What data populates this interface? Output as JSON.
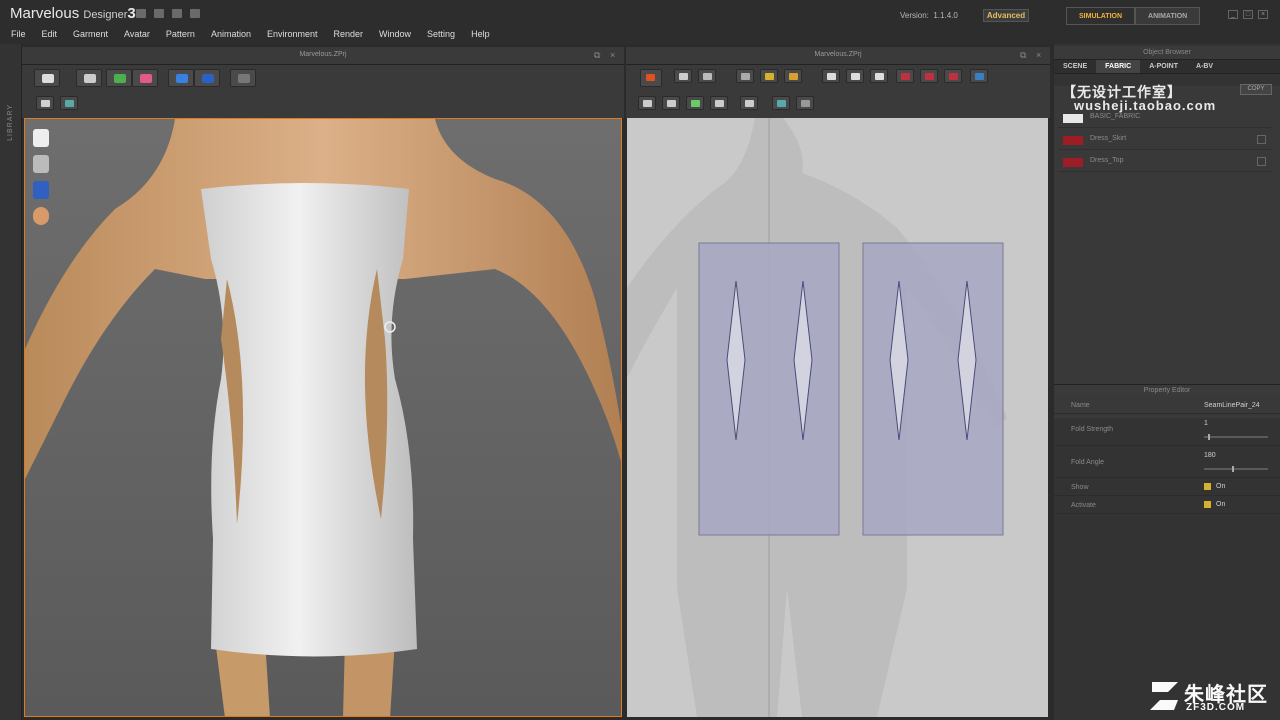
{
  "app": {
    "name": "Marvelous",
    "name_sub": "Designer",
    "version_num": "3",
    "version_label": "Version:",
    "version_value": "1.1.4.0",
    "edition": "Advanced",
    "mode_tabs": [
      "SIMULATION",
      "ANIMATION"
    ],
    "active_mode": "SIMULATION"
  },
  "menu": [
    "File",
    "Edit",
    "Garment",
    "Avatar",
    "Pattern",
    "Animation",
    "Environment",
    "Render",
    "Window",
    "Setting",
    "Help"
  ],
  "library_label": "LIBRARY",
  "left_panel": {
    "title": "Marvelous.ZPrj"
  },
  "right_view": {
    "title": "Marvelous.ZPrj"
  },
  "object_browser": {
    "title": "Object Browser",
    "tabs": [
      "SCENE",
      "FABRIC",
      "A-POINT",
      "A-BV"
    ],
    "active_tab": "FABRIC",
    "copy_label": "COPY",
    "fabrics": [
      {
        "name": "BASIC_FABRIC",
        "color": "#e8e8e8"
      },
      {
        "name": "Dress_Skirt",
        "color": "#9c1d24"
      },
      {
        "name": "Dress_Top",
        "color": "#9c1d24"
      }
    ]
  },
  "watermark": {
    "cn": "【无设计工作室】",
    "url": "wusheji.taobao.com"
  },
  "property_editor": {
    "title": "Property Editor",
    "name_label": "Name",
    "name_value": "SeamLinePair_24",
    "fold_strength_label": "Fold Strength",
    "fold_strength_value": "1",
    "fold_angle_label": "Fold Angle",
    "fold_angle_value": "180",
    "show_label": "Show",
    "show_value": "On",
    "activate_label": "Activate",
    "activate_value": "On"
  },
  "corner_logo": {
    "cn": "朱峰社区",
    "en": "ZF3D.COM"
  },
  "colors": {
    "accent": "#e07a20",
    "fabric_red": "#9c1d24",
    "pattern_fill": "#a7a8c4",
    "check": "#d8b030"
  }
}
